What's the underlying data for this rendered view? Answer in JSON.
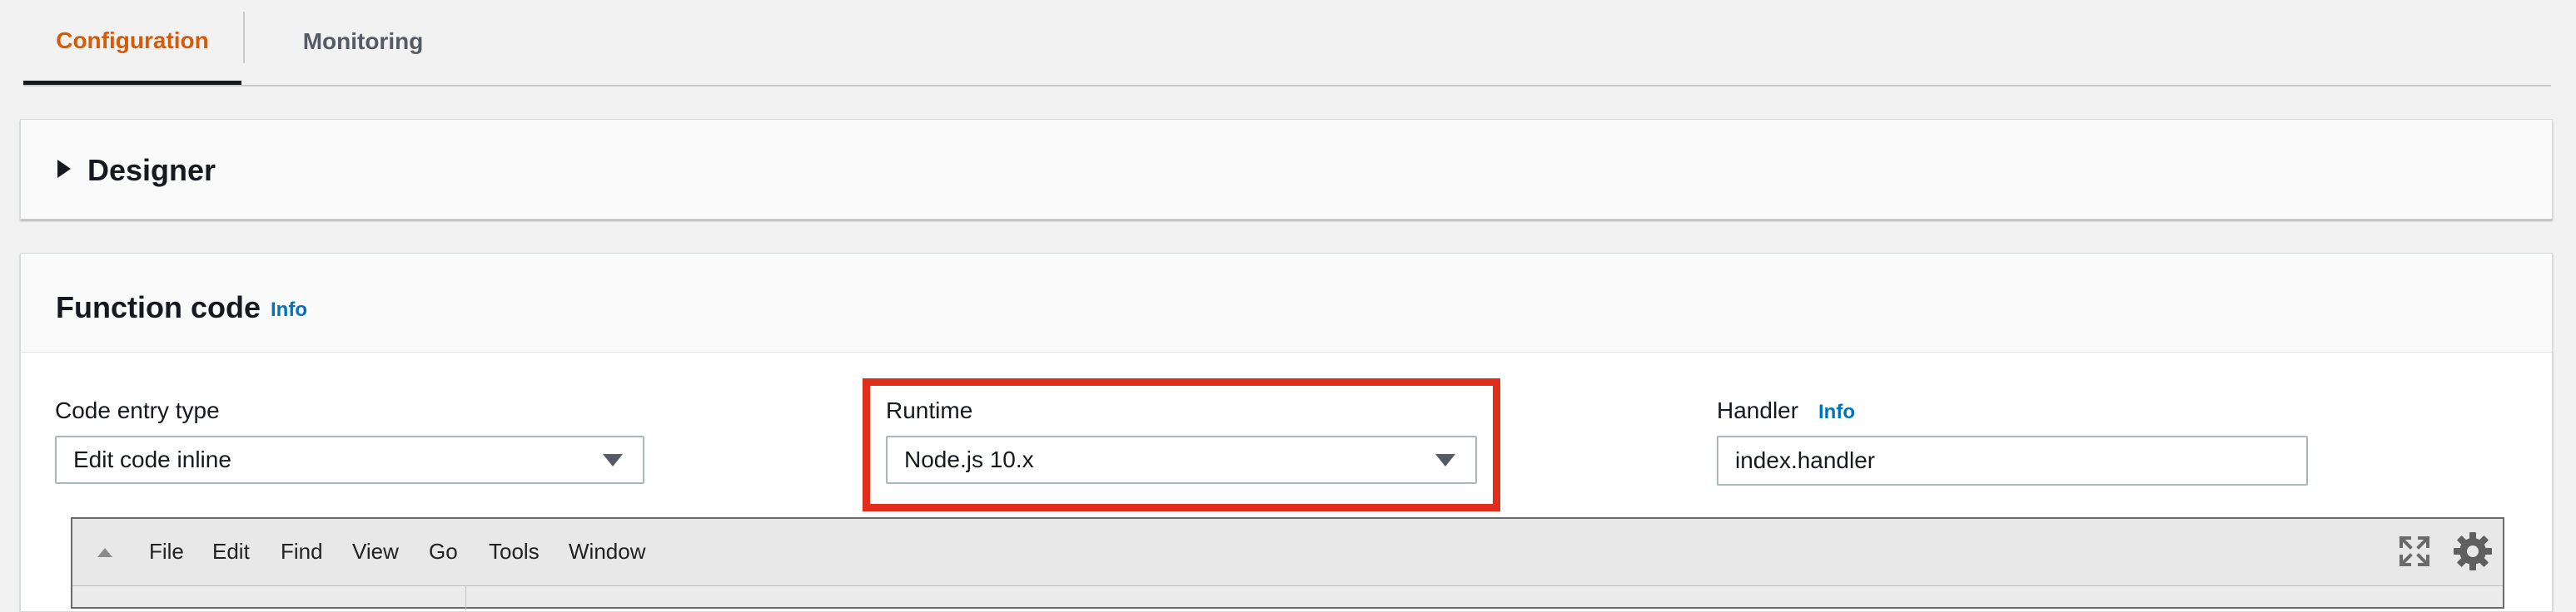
{
  "tabs": [
    {
      "label": "Configuration",
      "active": true
    },
    {
      "label": "Monitoring",
      "active": false
    }
  ],
  "designer": {
    "title": "Designer"
  },
  "function_code": {
    "title": "Function code",
    "info_link": "Info",
    "code_entry_type": {
      "label": "Code entry type",
      "value": "Edit code inline"
    },
    "runtime": {
      "label": "Runtime",
      "value": "Node.js 10.x"
    },
    "handler": {
      "label": "Handler",
      "info_link": "Info",
      "value": "index.handler"
    }
  },
  "editor": {
    "menu": [
      "File",
      "Edit",
      "Find",
      "View",
      "Go",
      "Tools",
      "Window"
    ]
  },
  "colors": {
    "accent": "#d45b07",
    "link": "#0073bb",
    "highlight": "#e02e1c"
  },
  "icons": [
    "caret-right-icon",
    "dropdown-arrow-icon",
    "collapse-up-icon",
    "fullscreen-icon",
    "gear-icon"
  ]
}
